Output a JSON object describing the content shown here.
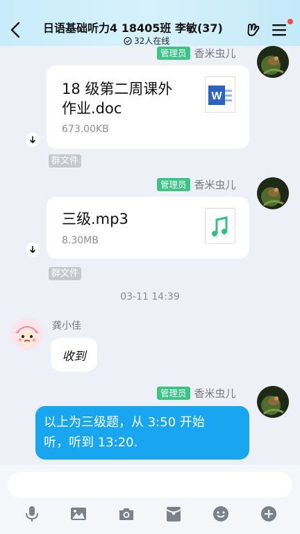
{
  "header": {
    "title": "日语基础听力4 18405班 李敏(37)",
    "online": "32人在线"
  },
  "messages": {
    "m1": {
      "badge": "管理员",
      "sender": "香米虫儿",
      "file_name_line1": "18 级第二周课外",
      "file_name_line2": "作业.doc",
      "file_size": "673.00KB",
      "tag": "群文件"
    },
    "m2": {
      "badge": "管理员",
      "sender": "香米虫儿",
      "file_name": "三级.mp3",
      "file_size": "8.30MB",
      "tag": "群文件"
    },
    "timestamp": "03-11 14:39",
    "m3": {
      "sender": "龚小佳",
      "text": "收到"
    },
    "m4": {
      "badge": "管理员",
      "sender": "香米虫儿",
      "text_line1": "以上为三级题，从 3:50 开始",
      "text_line2": "听，听到 13:20."
    }
  },
  "colors": {
    "accent_blue": "#18a6f0",
    "admin_green": "#3cc487",
    "header_bg": "#c8ecfb"
  },
  "toolbar": {
    "icons": [
      "microphone-icon",
      "image-icon",
      "camera-icon",
      "red-packet-icon",
      "emoji-icon",
      "plus-icon"
    ]
  }
}
